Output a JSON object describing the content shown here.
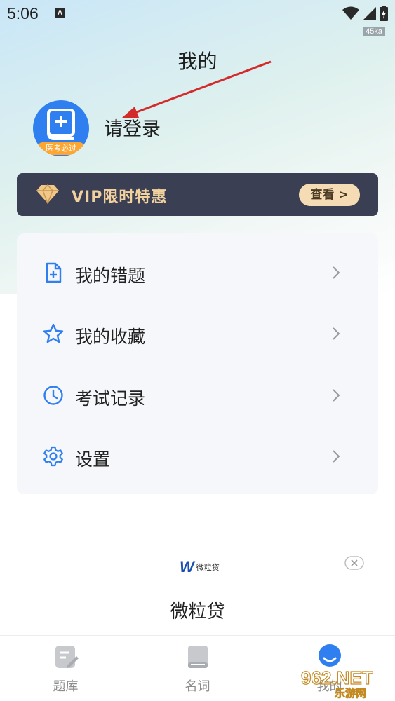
{
  "status_bar": {
    "time": "5:06",
    "notification_letter": "A",
    "speed_badge": "45ka"
  },
  "page": {
    "title": "我的"
  },
  "profile": {
    "login_prompt": "请登录",
    "avatar_badge_text": "医考必过"
  },
  "vip_banner": {
    "label": "VIP限时特惠",
    "button_label": "查看 >"
  },
  "menu": {
    "items": [
      {
        "label": "我的错题",
        "icon": "document-plus-icon"
      },
      {
        "label": "我的收藏",
        "icon": "star-icon"
      },
      {
        "label": "考试记录",
        "icon": "clock-icon"
      },
      {
        "label": "设置",
        "icon": "gear-icon"
      }
    ]
  },
  "ad": {
    "logo_text": "微粒贷",
    "logo_letter": "W",
    "title": "微粒贷"
  },
  "tabbar": {
    "tabs": [
      {
        "label": "题库",
        "icon": "question-bank-icon"
      },
      {
        "label": "名词",
        "icon": "book-icon"
      },
      {
        "label": "我的",
        "icon": "profile-icon",
        "active": true
      }
    ]
  },
  "watermark": {
    "text": "962.NET",
    "subtext": "乐游网"
  },
  "colors": {
    "accent_blue": "#2f7ff0",
    "vip_banner_bg": "#3b3f53",
    "vip_gold": "#f1d19e",
    "menu_bg": "#f5f7fa",
    "annotation_arrow": "#d42a2a"
  }
}
